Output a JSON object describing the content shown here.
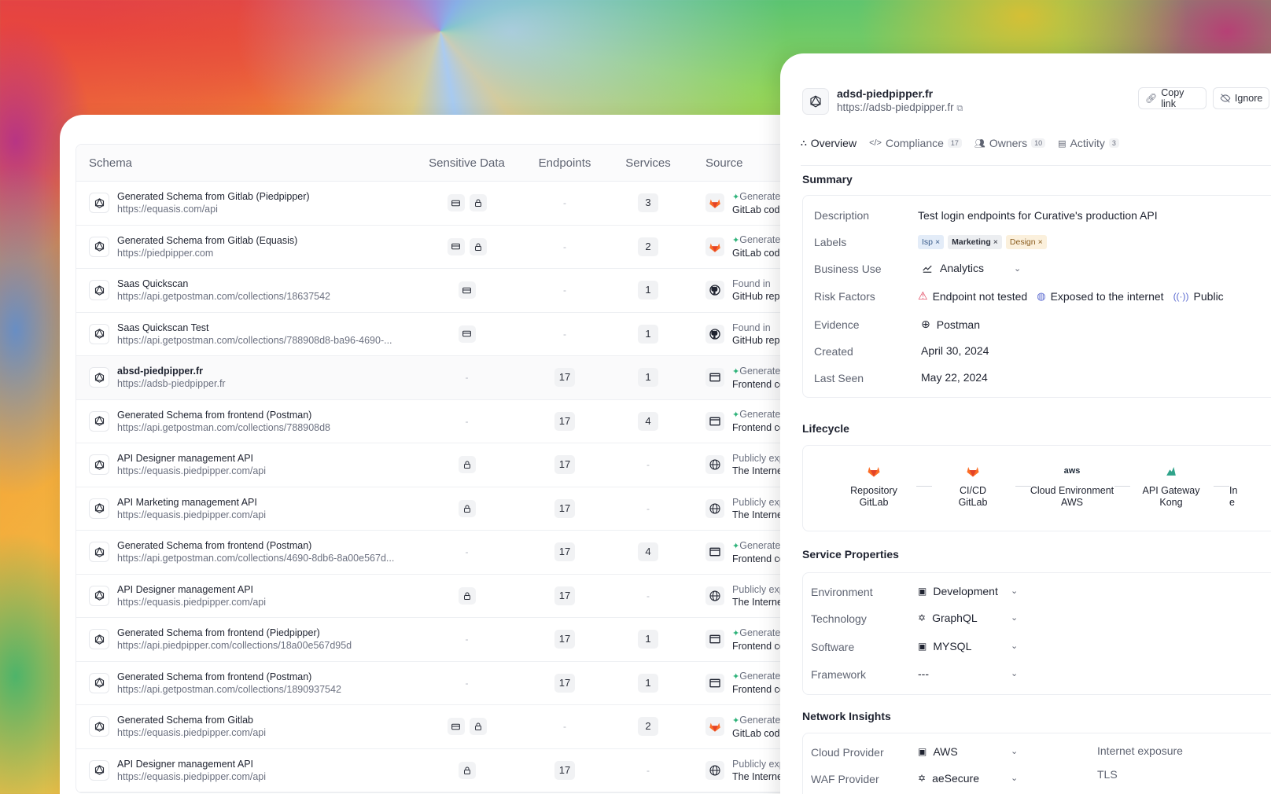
{
  "table": {
    "headers": {
      "schema": "Schema",
      "sensitive": "Sensitive Data",
      "endpoints": "Endpoints",
      "services": "Services",
      "source": "Source"
    },
    "rows": [
      {
        "name": "Generated Schema from Gitlab (Piedpipper)",
        "url": "https://equasis.com/api",
        "sensitive": [
          "card",
          "lock"
        ],
        "endpoints": "-",
        "services": "3",
        "source_icon": "gitlab-icon",
        "source_l1": "Generated",
        "source_l2": "GitLab code",
        "generated": true
      },
      {
        "name": "Generated Schema from Gitlab (Equasis)",
        "url": "https://piedpipper.com",
        "sensitive": [
          "card",
          "lock"
        ],
        "endpoints": "-",
        "services": "2",
        "source_icon": "gitlab-icon",
        "source_l1": "Generated",
        "source_l2": "GitLab code",
        "generated": true
      },
      {
        "name": "Saas Quickscan",
        "url": "https://api.getpostman.com/collections/18637542",
        "sensitive": [
          "card"
        ],
        "endpoints": "-",
        "services": "1",
        "source_icon": "github-icon",
        "source_l1": "Found in",
        "source_l2": "GitHub repo",
        "generated": false
      },
      {
        "name": "Saas Quickscan Test",
        "url": "https://api.getpostman.com/collections/788908d8-ba96-4690-...",
        "sensitive": [
          "card"
        ],
        "endpoints": "-",
        "services": "1",
        "source_icon": "github-icon",
        "source_l1": "Found in",
        "source_l2": "GitHub repo",
        "generated": false
      },
      {
        "name": "absd-piedpipper.fr",
        "url": "https://adsb-piedpipper.fr",
        "sensitive": [],
        "endpoints": "17",
        "services": "1",
        "source_icon": "window-icon",
        "source_l1": "Generated",
        "source_l2": "Frontend co",
        "generated": true,
        "highlight": true
      },
      {
        "name": "Generated Schema from frontend (Postman)",
        "url": "https://api.getpostman.com/collections/788908d8",
        "sensitive": [],
        "endpoints": "17",
        "services": "4",
        "source_icon": "window-icon",
        "source_l1": "Generated",
        "source_l2": "Frontend co",
        "generated": true
      },
      {
        "name": "API Designer management API",
        "url": "https://equasis.piedpipper.com/api",
        "sensitive": [
          "lock"
        ],
        "endpoints": "17",
        "services": "-",
        "source_icon": "globe-icon",
        "source_l1": "Publicly exp",
        "source_l2": "The Internet",
        "generated": false
      },
      {
        "name": "API Marketing management API",
        "url": "https://equasis.piedpipper.com/api",
        "sensitive": [
          "lock"
        ],
        "endpoints": "17",
        "services": "-",
        "source_icon": "globe-icon",
        "source_l1": "Publicly exp",
        "source_l2": "The Internet",
        "generated": false
      },
      {
        "name": "Generated Schema from frontend (Postman)",
        "url": "https://api.getpostman.com/collections/4690-8db6-8a00e567d...",
        "sensitive": [],
        "endpoints": "17",
        "services": "4",
        "source_icon": "window-icon",
        "source_l1": "Generated",
        "source_l2": "Frontend co",
        "generated": true
      },
      {
        "name": "API Designer management API",
        "url": "https://equasis.piedpipper.com/api",
        "sensitive": [
          "lock"
        ],
        "endpoints": "17",
        "services": "-",
        "source_icon": "globe-icon",
        "source_l1": "Publicly exp",
        "source_l2": "The Internet",
        "generated": false
      },
      {
        "name": "Generated Schema from frontend (Piedpipper)",
        "url": "https://api.piedpipper.com/collections/18a00e567d95d",
        "sensitive": [],
        "endpoints": "17",
        "services": "1",
        "source_icon": "window-icon",
        "source_l1": "Generated",
        "source_l2": "Frontend co",
        "generated": true
      },
      {
        "name": "Generated Schema from frontend (Postman)",
        "url": "https://api.getpostman.com/collections/1890937542",
        "sensitive": [],
        "endpoints": "17",
        "services": "1",
        "source_icon": "window-icon",
        "source_l1": "Generated",
        "source_l2": "Frontend co",
        "generated": true
      },
      {
        "name": "Generated Schema from Gitlab",
        "url": "https://equasis.piedpipper.com/api",
        "sensitive": [
          "card",
          "lock"
        ],
        "endpoints": "-",
        "services": "2",
        "source_icon": "gitlab-icon",
        "source_l1": "Generated",
        "source_l2": "GitLab code",
        "generated": true
      },
      {
        "name": "API Designer management API",
        "url": "https://equasis.piedpipper.com/api",
        "sensitive": [
          "lock"
        ],
        "endpoints": "17",
        "services": "-",
        "source_icon": "globe-icon",
        "source_l1": "Publicly exp",
        "source_l2": "The Internet",
        "generated": false
      }
    ]
  },
  "panel": {
    "title": "adsd-piedpipper.fr",
    "url": "https://adsb-piedpipper.fr",
    "copy_link": "Copy link",
    "ignore": "Ignore",
    "tabs": [
      {
        "label": "Overview",
        "badge": ""
      },
      {
        "label": "Compliance",
        "badge": "17"
      },
      {
        "label": "Owners",
        "badge": "10"
      },
      {
        "label": "Activity",
        "badge": "3"
      }
    ],
    "summary": {
      "title": "Summary",
      "description_label": "Description",
      "description": "Test login endpoints for Curative's production API",
      "labels_label": "Labels",
      "labels": [
        "Isp",
        "Marketing",
        "Design"
      ],
      "business_use_label": "Business Use",
      "business_use": "Analytics",
      "risk_label": "Risk Factors",
      "risks": [
        "Endpoint not tested",
        "Exposed to the internet",
        "Public"
      ],
      "evidence_label": "Evidence",
      "evidence": "Postman",
      "created_label": "Created",
      "created": "April 30, 2024",
      "last_seen_label": "Last Seen",
      "last_seen": "May 22, 2024"
    },
    "lifecycle": {
      "title": "Lifecycle",
      "items": [
        {
          "l1": "Repository",
          "l2": "GitLab"
        },
        {
          "l1": "CI/CD",
          "l2": "GitLab"
        },
        {
          "l1": "Cloud Environment",
          "l2": "AWS"
        },
        {
          "l1": "API Gateway",
          "l2": "Kong"
        },
        {
          "l1": "In",
          "l2": "e"
        }
      ]
    },
    "service_properties": {
      "title": "Service Properties",
      "environment_label": "Environment",
      "environment": "Development",
      "technology_label": "Technology",
      "technology": "GraphQL",
      "software_label": "Software",
      "software": "MYSQL",
      "framework_label": "Framework",
      "framework": "---"
    },
    "network": {
      "title": "Network Insights",
      "cloud_label": "Cloud Provider",
      "cloud": "AWS",
      "waf_label": "WAF Provider",
      "waf": "aeSecure",
      "exposure_label": "Internet exposure",
      "tls_label": "TLS"
    }
  }
}
